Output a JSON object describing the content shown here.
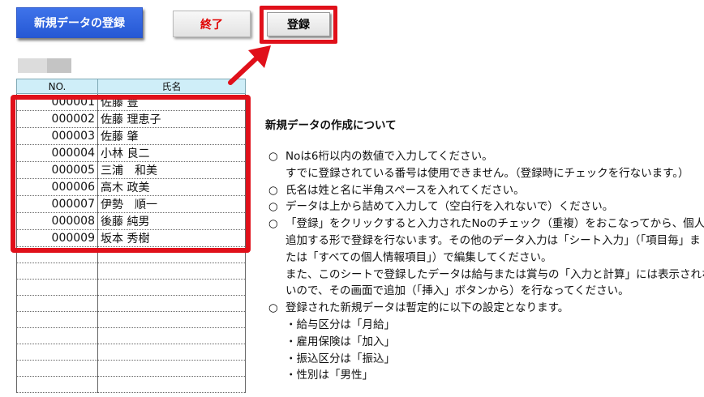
{
  "toolbar": {
    "new_data_label": "新規データの登録",
    "end_label": "終了",
    "register_label": "登録"
  },
  "table": {
    "headers": [
      "NO.",
      "氏名"
    ],
    "rows": [
      {
        "no": "000001",
        "name": "佐藤 豊"
      },
      {
        "no": "000002",
        "name": "佐藤 理恵子"
      },
      {
        "no": "000003",
        "name": "佐藤 肇"
      },
      {
        "no": "000004",
        "name": "小林 良二"
      },
      {
        "no": "000005",
        "name": "三浦　和美"
      },
      {
        "no": "000006",
        "name": "高木 政美"
      },
      {
        "no": "000007",
        "name": "伊勢　順一"
      },
      {
        "no": "000008",
        "name": "後藤 純男"
      },
      {
        "no": "000009",
        "name": "坂本 秀樹"
      },
      {
        "no": "",
        "name": ""
      },
      {
        "no": "",
        "name": ""
      },
      {
        "no": "",
        "name": ""
      },
      {
        "no": "",
        "name": ""
      },
      {
        "no": "",
        "name": ""
      },
      {
        "no": "",
        "name": ""
      },
      {
        "no": "",
        "name": ""
      },
      {
        "no": "",
        "name": ""
      },
      {
        "no": "",
        "name": ""
      }
    ]
  },
  "info": {
    "title": "新規データの作成について",
    "bullet": "○",
    "item1": "Noは6桁以内の数値で入力してください。",
    "item1_cont": "すでに登録されている番号は使用できません。（登録時にチェックを行ないます。）",
    "item2": "氏名は姓と名に半角スペースを入れてください。",
    "item3": "データは上から詰めて入力して（空白行を入れないで）ください。",
    "item4": "「登録」をクリックすると入力されたNoのチェック（重複）をおこなってから、個人情報に",
    "item4_cont1": "追加する形で登録を行ないます。その他のデータ入力は「シート入力」（「項目毎」ま",
    "item4_cont2": "たは「すべての個人情報項目」）で編集してください。",
    "item4_cont3": "また、このシートで登録したデータは給与または賞与の「入力と計算」には表示されな",
    "item4_cont4": "いので、その画面で追加（「挿入」ボタンから）を行なってください。",
    "item5": "登録された新規データは暫定的に以下の設定となります。",
    "sub1": "・給与区分は「月給」",
    "sub2": "・雇用保険は「加入」",
    "sub3": "・振込区分は「振込」",
    "sub4": "・性別は「男性」"
  },
  "colors": {
    "accent_blue": "#2f63df",
    "highlight_red": "#e0101a",
    "end_text": "#e00000",
    "header_bg": "#cfeef8"
  }
}
